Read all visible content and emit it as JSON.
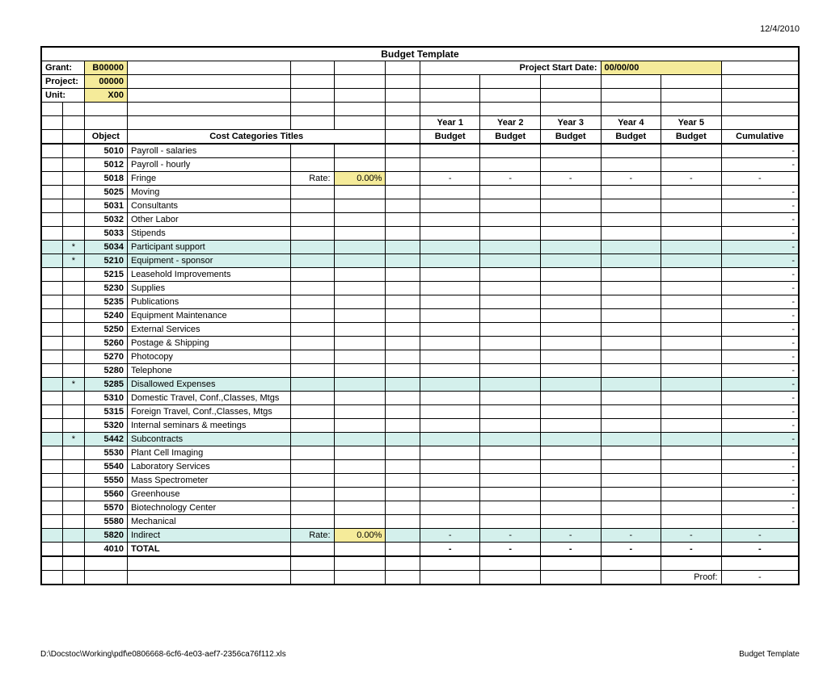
{
  "date_header": "12/4/2010",
  "title": "Budget Template",
  "meta": {
    "grant_label": "Grant:",
    "grant_value": "B00000",
    "project_label": "Project:",
    "project_value": "00000",
    "unit_label": "Unit:",
    "unit_value": "X00",
    "start_date_label": "Project Start Date:",
    "start_date_value": "00/00/00"
  },
  "headers": {
    "object": "Object",
    "cost_cat": "Cost Categories Titles",
    "y1a": "Year 1",
    "y1b": "Budget",
    "y2a": "Year 2",
    "y2b": "Budget",
    "y3a": "Year 3",
    "y3b": "Budget",
    "y4a": "Year 4",
    "y4b": "Budget",
    "y5a": "Year 5",
    "y5b": "Budget",
    "cum": "Cumulative"
  },
  "rate_label": "Rate:",
  "rate_value": "0.00%",
  "dash": "-",
  "star": "*",
  "rows": [
    {
      "obj": "5010",
      "title": "Payroll - salaries",
      "hl": false,
      "star": false,
      "rate": false,
      "dashes": false
    },
    {
      "obj": "5012",
      "title": "Payroll - hourly",
      "hl": false,
      "star": false,
      "rate": false,
      "dashes": false
    },
    {
      "obj": "5018",
      "title": "Fringe",
      "hl": false,
      "star": false,
      "rate": true,
      "dashes": true
    },
    {
      "obj": "5025",
      "title": "Moving",
      "hl": false,
      "star": false,
      "rate": false,
      "dashes": false
    },
    {
      "obj": "5031",
      "title": "Consultants",
      "hl": false,
      "star": false,
      "rate": false,
      "dashes": false
    },
    {
      "obj": "5032",
      "title": "Other Labor",
      "hl": false,
      "star": false,
      "rate": false,
      "dashes": false
    },
    {
      "obj": "5033",
      "title": "Stipends",
      "hl": false,
      "star": false,
      "rate": false,
      "dashes": false
    },
    {
      "obj": "5034",
      "title": "Participant support",
      "hl": true,
      "star": true,
      "rate": false,
      "dashes": false
    },
    {
      "obj": "5210",
      "title": "Equipment - sponsor",
      "hl": true,
      "star": true,
      "rate": false,
      "dashes": false
    },
    {
      "obj": "5215",
      "title": "Leasehold Improvements",
      "hl": false,
      "star": false,
      "rate": false,
      "dashes": false
    },
    {
      "obj": "5230",
      "title": "Supplies",
      "hl": false,
      "star": false,
      "rate": false,
      "dashes": false
    },
    {
      "obj": "5235",
      "title": "Publications",
      "hl": false,
      "star": false,
      "rate": false,
      "dashes": false
    },
    {
      "obj": "5240",
      "title": "Equipment Maintenance",
      "hl": false,
      "star": false,
      "rate": false,
      "dashes": false
    },
    {
      "obj": "5250",
      "title": "External Services",
      "hl": false,
      "star": false,
      "rate": false,
      "dashes": false
    },
    {
      "obj": "5260",
      "title": "Postage & Shipping",
      "hl": false,
      "star": false,
      "rate": false,
      "dashes": false
    },
    {
      "obj": "5270",
      "title": "Photocopy",
      "hl": false,
      "star": false,
      "rate": false,
      "dashes": false
    },
    {
      "obj": "5280",
      "title": "Telephone",
      "hl": false,
      "star": false,
      "rate": false,
      "dashes": false
    },
    {
      "obj": "5285",
      "title": "Disallowed Expenses",
      "hl": true,
      "star": true,
      "rate": false,
      "dashes": false
    },
    {
      "obj": "5310",
      "title": "Domestic Travel, Conf.,Classes, Mtgs",
      "hl": false,
      "star": false,
      "rate": false,
      "dashes": false
    },
    {
      "obj": "5315",
      "title": "Foreign Travel, Conf.,Classes, Mtgs",
      "hl": false,
      "star": false,
      "rate": false,
      "dashes": false
    },
    {
      "obj": "5320",
      "title": "Internal seminars & meetings",
      "hl": false,
      "star": false,
      "rate": false,
      "dashes": false
    },
    {
      "obj": "5442",
      "title": "Subcontracts",
      "hl": true,
      "star": true,
      "rate": false,
      "dashes": false
    },
    {
      "obj": "5530",
      "title": "Plant Cell Imaging",
      "hl": false,
      "star": false,
      "rate": false,
      "dashes": false
    },
    {
      "obj": "5540",
      "title": "Laboratory Services",
      "hl": false,
      "star": false,
      "rate": false,
      "dashes": false
    },
    {
      "obj": "5550",
      "title": "Mass Spectrometer",
      "hl": false,
      "star": false,
      "rate": false,
      "dashes": false
    },
    {
      "obj": "5560",
      "title": "Greenhouse",
      "hl": false,
      "star": false,
      "rate": false,
      "dashes": false
    },
    {
      "obj": "5570",
      "title": "Biotechnology Center",
      "hl": false,
      "star": false,
      "rate": false,
      "dashes": false
    },
    {
      "obj": "5580",
      "title": "Mechanical",
      "hl": false,
      "star": false,
      "rate": false,
      "dashes": false
    },
    {
      "obj": "5820",
      "title": "Indirect",
      "hl": true,
      "star": false,
      "rate": true,
      "dashes": true
    },
    {
      "obj": "4010",
      "title": "TOTAL",
      "hl": false,
      "star": false,
      "rate": false,
      "dashes": true,
      "bold": true,
      "thickBottom": true
    }
  ],
  "proof_label": "Proof:",
  "footer": {
    "left": "D:\\Docstoc\\Working\\pdf\\e0806668-6cf6-4e03-aef7-2356ca76f112.xls",
    "right": "Budget Template"
  }
}
